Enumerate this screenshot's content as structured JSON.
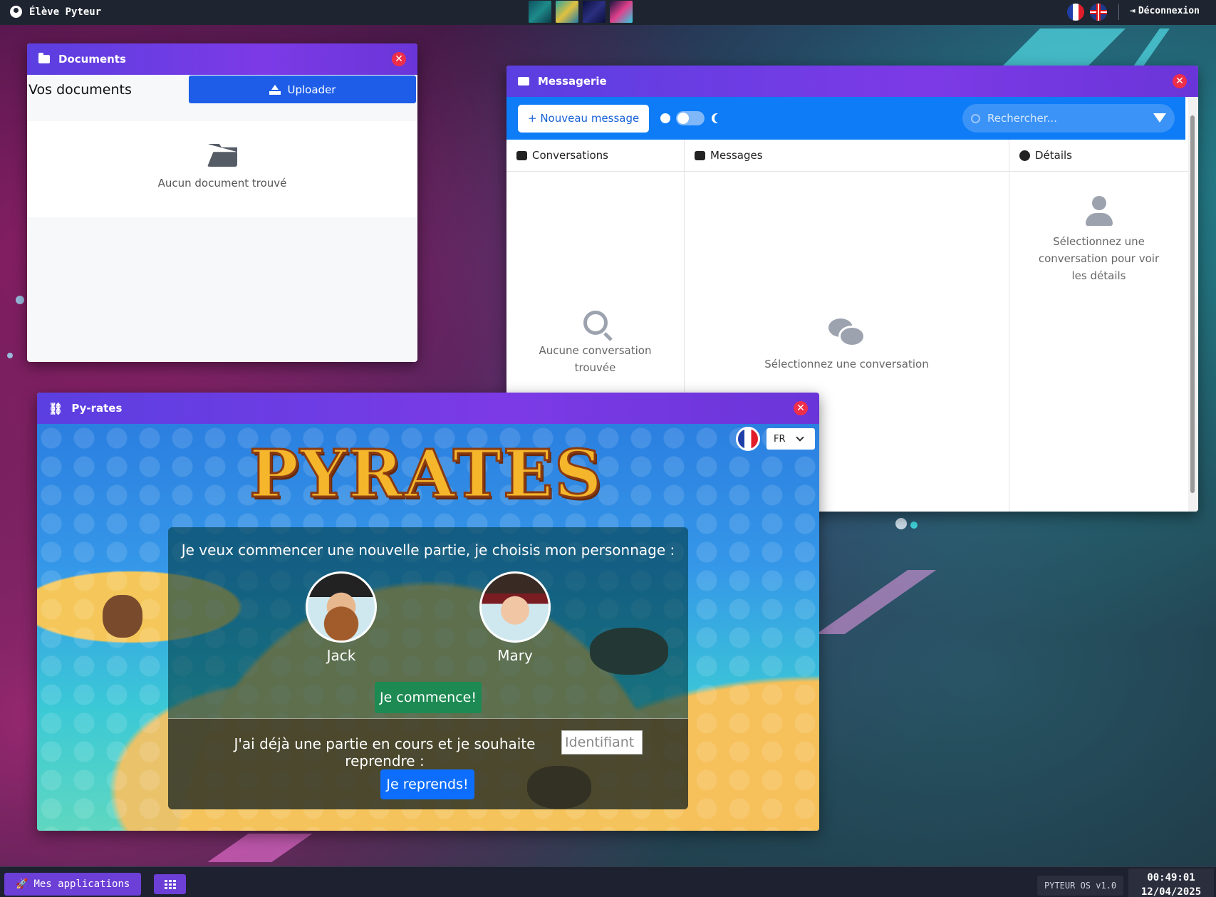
{
  "topbar": {
    "user_name": "Élève Pyteur",
    "logout_label": "Déconnexion",
    "languages": [
      "fr",
      "en"
    ]
  },
  "documents": {
    "title": "Documents",
    "heading": "Vos documents",
    "upload_label": "Uploader",
    "empty_text": "Aucun document trouvé"
  },
  "messagerie": {
    "title": "Messagerie",
    "new_message_label": "+ Nouveau message",
    "search_placeholder": "Rechercher...",
    "columns": {
      "conversations": "Conversations",
      "messages": "Messages",
      "details": "Détails"
    },
    "empty_conversations": "Aucune conversation trouvée",
    "empty_messages": "Sélectionnez une conversation",
    "empty_details": "Sélectionnez une conversation pour voir les détails"
  },
  "pyrates": {
    "title": "Py-rates",
    "logo_text": "PYRATES",
    "language": "FR",
    "new_game_text": "Je veux commencer une nouvelle partie, je choisis mon personnage :",
    "characters": [
      {
        "name": "Jack"
      },
      {
        "name": "Mary"
      }
    ],
    "start_label": "Je commence!",
    "resume_text": "J'ai déjà une partie en cours et je souhaite reprendre :",
    "id_placeholder": "Identifiant",
    "resume_label": "Je reprends!"
  },
  "taskbar": {
    "apps_label": "Mes applications",
    "version": "PYTEUR OS v1.0",
    "time": "00:49:01",
    "date": "12/04/2025"
  },
  "colors": {
    "accent_purple": "#6c3fd6",
    "title_gradient": "#7c3ae6",
    "primary_blue": "#0d7cf6",
    "close_red": "#ef2e4a",
    "start_green": "#1d8a53"
  }
}
